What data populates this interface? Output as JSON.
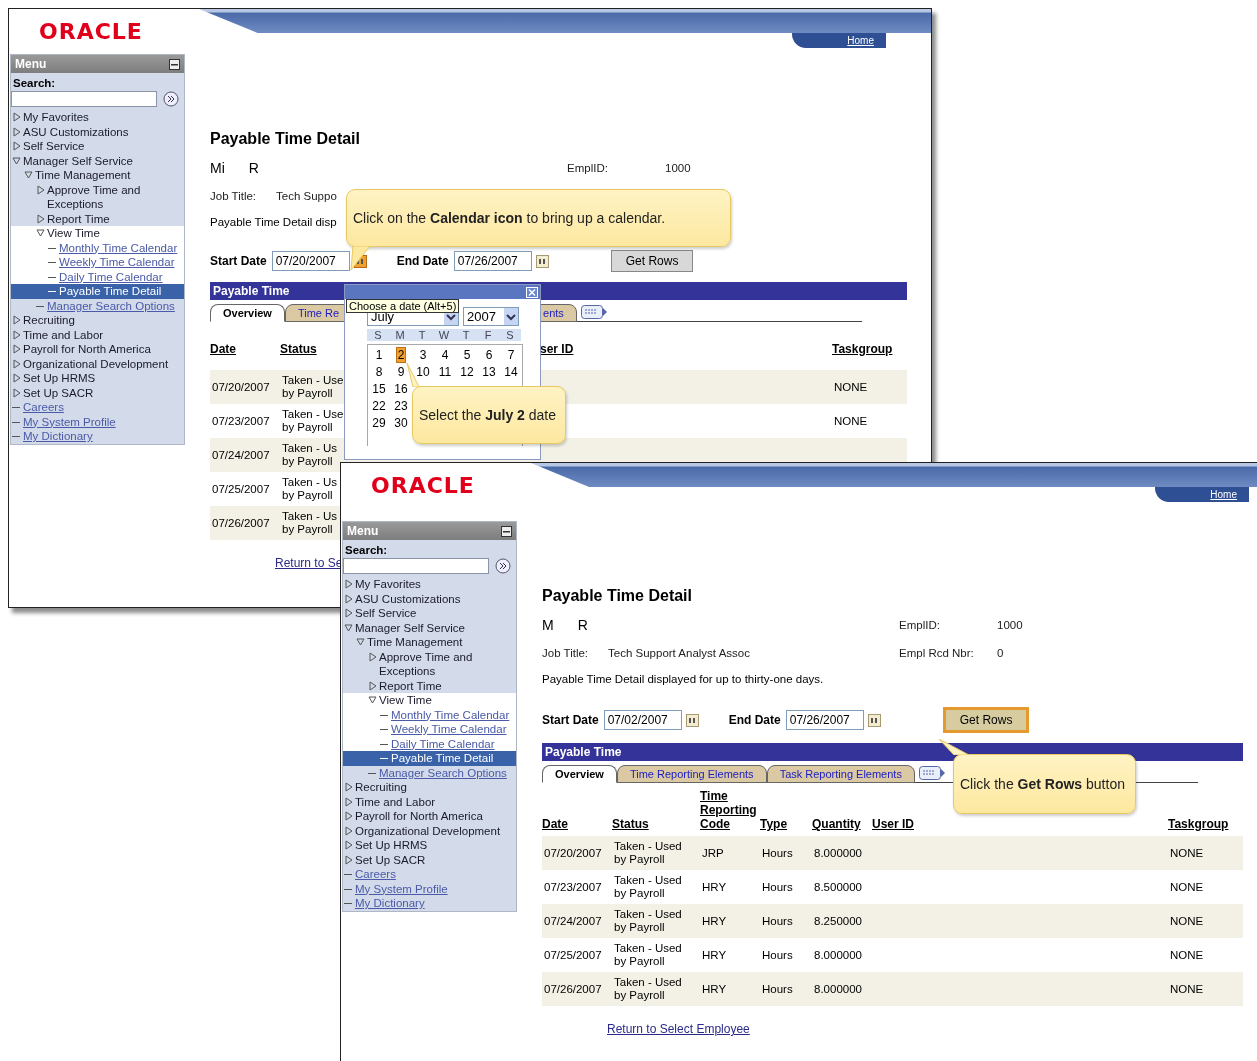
{
  "windows": [
    {
      "kind": "calendar_step",
      "logo": "ORACLE",
      "home": "Home",
      "menu": {
        "title": "Menu",
        "search_label": "Search:",
        "items": [
          {
            "label": "My Favorites",
            "kind": "folder",
            "expanded": false,
            "selected": false
          },
          {
            "label": "ASU Customizations",
            "kind": "folder",
            "expanded": false,
            "selected": false
          },
          {
            "label": "Self Service",
            "kind": "folder",
            "expanded": false,
            "selected": false
          },
          {
            "label": "Manager Self Service",
            "kind": "folder",
            "expanded": true,
            "selected": false,
            "children": [
              {
                "label": "Time Management",
                "kind": "folder",
                "expanded": true,
                "selected": false,
                "children": [
                  {
                    "label": "Approve Time and Exceptions",
                    "kind": "folder",
                    "expanded": false,
                    "selected": false
                  },
                  {
                    "label": "Report Time",
                    "kind": "folder",
                    "expanded": false,
                    "selected": false
                  },
                  {
                    "label": "View Time",
                    "kind": "folder",
                    "expanded": true,
                    "selected": false,
                    "children": [
                      {
                        "label": "Monthly Time Calendar",
                        "kind": "link",
                        "selected": false
                      },
                      {
                        "label": "Weekly Time Calendar",
                        "kind": "link",
                        "selected": false
                      },
                      {
                        "label": "Daily Time Calendar",
                        "kind": "link",
                        "selected": false
                      },
                      {
                        "label": "Payable Time Detail",
                        "kind": "link",
                        "selected": true
                      }
                    ]
                  },
                  {
                    "label": "Manager Search Options",
                    "kind": "link",
                    "selected": false
                  }
                ]
              }
            ]
          },
          {
            "label": "Recruiting",
            "kind": "folder",
            "expanded": false,
            "selected": false
          },
          {
            "label": "Time and Labor",
            "kind": "folder",
            "expanded": false,
            "selected": false
          },
          {
            "label": "Payroll for North America",
            "kind": "folder",
            "expanded": false,
            "selected": false
          },
          {
            "label": "Organizational Development",
            "kind": "folder",
            "expanded": false,
            "selected": false
          },
          {
            "label": "Set Up HRMS",
            "kind": "folder",
            "expanded": false,
            "selected": false
          },
          {
            "label": "Set Up SACR",
            "kind": "folder",
            "expanded": false,
            "selected": false
          },
          {
            "label": "Careers",
            "kind": "link",
            "selected": false
          },
          {
            "label": "My System Profile",
            "kind": "link",
            "selected": false
          },
          {
            "label": "My Dictionary",
            "kind": "link",
            "selected": false
          }
        ]
      },
      "page": {
        "title": "Payable Time Detail",
        "name_first": "Mi",
        "name_last": "R",
        "emplid_label": "EmplID:",
        "emplid": "1000",
        "job_title_label": "Job Title:",
        "job_title": "Tech Suppo",
        "description": "Payable Time Detail disp",
        "start_label": "Start Date",
        "start_value": "07/20/2007",
        "start_calendar_highlighted": true,
        "end_label": "End Date",
        "end_value": "07/26/2007",
        "get_rows": "Get Rows",
        "get_rows_highlighted": false
      },
      "section": "Payable Time",
      "tabs": [
        {
          "label": "Overview",
          "selected": true
        },
        {
          "label": "Time Re",
          "selected": false
        },
        {
          "label": "ents",
          "selected": false
        }
      ],
      "columns": [
        {
          "label": "Date",
          "kind": "date"
        },
        {
          "label": "Status",
          "kind": "status"
        },
        {
          "label": "ser ID",
          "kind": "user_id"
        },
        {
          "label": "Taskgroup",
          "kind": "taskgroup"
        }
      ],
      "rows": [
        {
          "date": "07/20/2007",
          "status": [
            "Taken - Use",
            "by Payroll"
          ],
          "taskgroup": "NONE"
        },
        {
          "date": "07/23/2007",
          "status": [
            "Taken - Use",
            "by Payroll"
          ],
          "taskgroup": "NONE"
        },
        {
          "date": "07/24/2007",
          "status": [
            "Taken - Us",
            "by Payroll"
          ]
        },
        {
          "date": "07/25/2007",
          "status": [
            "Taken - Us",
            "by Payroll"
          ]
        },
        {
          "date": "07/26/2007",
          "status": [
            "Taken - Us",
            "by Payroll"
          ]
        }
      ],
      "return_link": "Return to Se",
      "calendar": {
        "tooltip": "Choose a date (Alt+5)",
        "month": "July",
        "year": "2007",
        "weekdays": [
          "S",
          "M",
          "T",
          "W",
          "T",
          "F",
          "S"
        ],
        "days": [
          {
            "label": "1",
            "selected": false
          },
          {
            "label": "2",
            "selected": true
          },
          {
            "label": "3",
            "selected": false
          },
          {
            "label": "4",
            "selected": false
          },
          {
            "label": "5",
            "selected": false
          },
          {
            "label": "6",
            "selected": false
          },
          {
            "label": "7",
            "selected": false
          },
          {
            "label": "8",
            "selected": false
          },
          {
            "label": "9",
            "selected": false
          },
          {
            "label": "10",
            "selected": false
          },
          {
            "label": "11",
            "selected": false
          },
          {
            "label": "12",
            "selected": false
          },
          {
            "label": "13",
            "selected": false
          },
          {
            "label": "14",
            "selected": false
          },
          {
            "label": "15",
            "selected": false
          },
          {
            "label": "16",
            "selected": false
          },
          {
            "label": "22",
            "selected": false
          },
          {
            "label": "23",
            "selected": false
          },
          {
            "label": "29",
            "selected": false
          },
          {
            "label": "30",
            "selected": false
          }
        ]
      },
      "callouts": [
        "Click on the **Calendar icon** to bring up a calendar.",
        "Select the **July 2** date"
      ]
    },
    {
      "kind": "get_rows_step",
      "logo": "ORACLE",
      "home": "Home",
      "menu": {
        "title": "Menu",
        "search_label": "Search:",
        "items": [
          {
            "label": "My Favorites",
            "kind": "folder",
            "expanded": false,
            "selected": false
          },
          {
            "label": "ASU Customizations",
            "kind": "folder",
            "expanded": false,
            "selected": false
          },
          {
            "label": "Self Service",
            "kind": "folder",
            "expanded": false,
            "selected": false
          },
          {
            "label": "Manager Self Service",
            "kind": "folder",
            "expanded": true,
            "selected": false,
            "children": [
              {
                "label": "Time Management",
                "kind": "folder",
                "expanded": true,
                "selected": false,
                "children": [
                  {
                    "label": "Approve Time and Exceptions",
                    "kind": "folder",
                    "expanded": false,
                    "selected": false
                  },
                  {
                    "label": "Report Time",
                    "kind": "folder",
                    "expanded": false,
                    "selected": false
                  },
                  {
                    "label": "View Time",
                    "kind": "folder",
                    "expanded": true,
                    "selected": false,
                    "children": [
                      {
                        "label": "Monthly Time Calendar",
                        "kind": "link",
                        "selected": false
                      },
                      {
                        "label": "Weekly Time Calendar",
                        "kind": "link",
                        "selected": false
                      },
                      {
                        "label": "Daily Time Calendar",
                        "kind": "link",
                        "selected": false
                      },
                      {
                        "label": "Payable Time Detail",
                        "kind": "link",
                        "selected": true
                      }
                    ]
                  },
                  {
                    "label": "Manager Search Options",
                    "kind": "link",
                    "selected": false
                  }
                ]
              }
            ]
          },
          {
            "label": "Recruiting",
            "kind": "folder",
            "expanded": false,
            "selected": false
          },
          {
            "label": "Time and Labor",
            "kind": "folder",
            "expanded": false,
            "selected": false
          },
          {
            "label": "Payroll for North America",
            "kind": "folder",
            "expanded": false,
            "selected": false
          },
          {
            "label": "Organizational Development",
            "kind": "folder",
            "expanded": false,
            "selected": false
          },
          {
            "label": "Set Up HRMS",
            "kind": "folder",
            "expanded": false,
            "selected": false
          },
          {
            "label": "Set Up SACR",
            "kind": "folder",
            "expanded": false,
            "selected": false
          },
          {
            "label": "Careers",
            "kind": "link",
            "selected": false
          },
          {
            "label": "My System Profile",
            "kind": "link",
            "selected": false
          },
          {
            "label": "My Dictionary",
            "kind": "link",
            "selected": false
          }
        ]
      },
      "page": {
        "title": "Payable Time Detail",
        "name_first": "M",
        "name_last": "R",
        "emplid_label": "EmplID:",
        "emplid": "1000",
        "job_title_label": "Job Title:",
        "job_title": "Tech Support Analyst Assoc",
        "rcd_label": "Empl Rcd Nbr:",
        "rcd": "0",
        "description": "Payable Time Detail displayed for up to thirty-one days.",
        "start_label": "Start Date",
        "start_value": "07/02/2007",
        "start_calendar_highlighted": false,
        "end_label": "End Date",
        "end_value": "07/26/2007",
        "get_rows": "Get Rows",
        "get_rows_highlighted": true
      },
      "section": "Payable Time",
      "tabs": [
        {
          "label": "Overview",
          "selected": true
        },
        {
          "label": "Time Reporting Elements",
          "selected": false
        },
        {
          "label": "Task Reporting Elements",
          "selected": false
        }
      ],
      "columns": [
        {
          "label": "Date",
          "kind": "date"
        },
        {
          "label": "Status",
          "kind": "status"
        },
        {
          "label": "Time Reporting Code",
          "kind": "code"
        },
        {
          "label": "Type",
          "kind": "type"
        },
        {
          "label": "Quantity",
          "kind": "quantity"
        },
        {
          "label": "User ID",
          "kind": "user_id"
        },
        {
          "label": "Taskgroup",
          "kind": "taskgroup"
        }
      ],
      "rows": [
        {
          "date": "07/20/2007",
          "status": [
            "Taken - Used",
            "by Payroll"
          ],
          "code": "JRP",
          "type": "Hours",
          "quantity": "8.000000",
          "taskgroup": "NONE"
        },
        {
          "date": "07/23/2007",
          "status": [
            "Taken - Used",
            "by Payroll"
          ],
          "code": "HRY",
          "type": "Hours",
          "quantity": "8.500000",
          "taskgroup": "NONE"
        },
        {
          "date": "07/24/2007",
          "status": [
            "Taken - Used",
            "by Payroll"
          ],
          "code": "HRY",
          "type": "Hours",
          "quantity": "8.250000",
          "taskgroup": "NONE"
        },
        {
          "date": "07/25/2007",
          "status": [
            "Taken - Used",
            "by Payroll"
          ],
          "code": "HRY",
          "type": "Hours",
          "quantity": "8.000000",
          "taskgroup": "NONE"
        },
        {
          "date": "07/26/2007",
          "status": [
            "Taken - Used",
            "by Payroll"
          ],
          "code": "HRY",
          "type": "Hours",
          "quantity": "8.000000",
          "taskgroup": "NONE"
        }
      ],
      "return_link": "Return to Select Employee",
      "callouts": [
        "Click the **Get Rows** button"
      ]
    }
  ]
}
